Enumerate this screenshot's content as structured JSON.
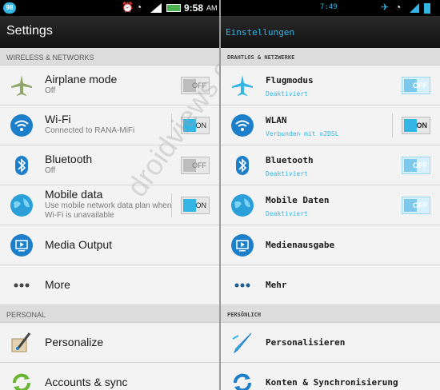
{
  "left": {
    "status": {
      "badge": "98",
      "time": "9:58",
      "ampm": "AM"
    },
    "title": "Settings",
    "section_wireless": "WIRELESS & NETWORKS",
    "section_personal": "PERSONAL",
    "items": [
      {
        "label": "Airplane mode",
        "sub": "Off",
        "toggle": "OFF",
        "icon": "airplane-icon"
      },
      {
        "label": "Wi-Fi",
        "sub": "Connected to RANA-MiFi",
        "toggle": "ON",
        "icon": "wifi-icon"
      },
      {
        "label": "Bluetooth",
        "sub": "Off",
        "toggle": "OFF",
        "icon": "bluetooth-icon"
      },
      {
        "label": "Mobile data",
        "sub": "Use mobile network data plan when Wi-Fi is unavailable",
        "toggle": "ON",
        "icon": "globe-icon"
      },
      {
        "label": "Media Output",
        "icon": "media-output-icon"
      },
      {
        "label": "More",
        "icon": "more-icon"
      },
      {
        "label": "Personalize",
        "icon": "brush-icon"
      },
      {
        "label": "Accounts & sync",
        "icon": "sync-icon"
      }
    ]
  },
  "right": {
    "status": {
      "time": "7:49"
    },
    "title": "Einstellungen",
    "section_wireless": "DRAHTLOS & NETZWERKE",
    "section_personal": "PERSÖNLICH",
    "items": [
      {
        "label": "Flugmodus",
        "sub": "Deaktiviert",
        "toggle": "OFF",
        "icon": "airplane-icon"
      },
      {
        "label": "WLAN",
        "sub": "Verbunden mit o2DSL",
        "toggle": "ON",
        "icon": "wifi-icon"
      },
      {
        "label": "Bluetooth",
        "sub": "Deaktiviert",
        "toggle": "OFF",
        "icon": "bluetooth-icon"
      },
      {
        "label": "Mobile Daten",
        "sub": "Deaktiviert",
        "toggle": "OFF",
        "icon": "globe-icon"
      },
      {
        "label": "Medienausgabe",
        "icon": "media-output-icon"
      },
      {
        "label": "Mehr",
        "icon": "more-icon"
      },
      {
        "label": "Personalisieren",
        "icon": "brush-icon"
      },
      {
        "label": "Konten & Synchronisierung",
        "icon": "sync-icon"
      }
    ]
  },
  "watermark": "droidviews.com",
  "colors": {
    "accent": "#33b5e5",
    "statusbar": "#000000",
    "toggle_on": "#33b5e5"
  }
}
